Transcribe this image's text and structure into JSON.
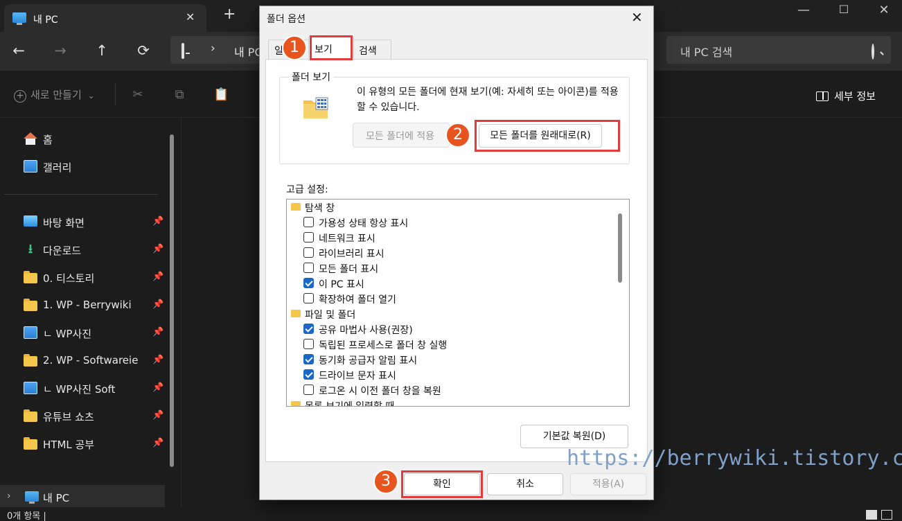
{
  "explorer": {
    "tab_title": "내 PC",
    "tab_close": "✕",
    "new_tab": "+",
    "window_controls": {
      "minimize": "—",
      "maximize": "☐",
      "close": "✕"
    },
    "nav": {
      "back": "←",
      "forward": "→",
      "up": "↑",
      "refresh": "⟳"
    },
    "address": {
      "chevron": "›",
      "crumb": "내 PC"
    },
    "search": {
      "placeholder": "내 PC 검색"
    },
    "command_bar": {
      "new_label": "새로 만들기",
      "new_chevron": "⌄",
      "details_label": "세부 정보"
    },
    "sidebar": {
      "items": [
        {
          "label": "홈",
          "icon": "home-icon",
          "pinned": false
        },
        {
          "label": "갤러리",
          "icon": "gallery-icon",
          "pinned": false
        },
        {
          "label": "바탕 화면",
          "icon": "desktop-icon",
          "pinned": true
        },
        {
          "label": "다운로드",
          "icon": "download-icon",
          "pinned": true
        },
        {
          "label": "0. 티스토리",
          "icon": "folder-icon",
          "pinned": true
        },
        {
          "label": "1. WP - Berrywiki",
          "icon": "folder-icon",
          "pinned": true
        },
        {
          "label": "ㄴ WP사진",
          "icon": "image-icon",
          "pinned": true
        },
        {
          "label": "2. WP - Softwareie",
          "icon": "folder-icon",
          "pinned": true
        },
        {
          "label": "ㄴ WP사진 Soft",
          "icon": "image-icon",
          "pinned": true
        },
        {
          "label": "유튜브 쇼츠",
          "icon": "folder-icon",
          "pinned": true
        },
        {
          "label": "HTML 공부",
          "icon": "folder-icon",
          "pinned": true
        }
      ],
      "pin_glyph": "📌",
      "this_pc": {
        "chevron": "›",
        "label": "내 PC"
      }
    },
    "status": {
      "text": "0개 항목  |"
    }
  },
  "dialog": {
    "title": "폴더 옵션",
    "close": "✕",
    "tabs": [
      {
        "label": "일반"
      },
      {
        "label": "보기"
      },
      {
        "label": "검색"
      }
    ],
    "folder_view": {
      "legend": "폴더 보기",
      "description": "이 유형의 모든 폴더에 현재 보기(예: 자세히 또는 아이콘)를 적용할 수 있습니다.",
      "apply_all": "모든 폴더에 적용",
      "reset_all": "모든 폴더를 원래대로(R)"
    },
    "advanced": {
      "label": "고급 설정:",
      "rows": [
        {
          "type": "group",
          "label": "탐색 창"
        },
        {
          "type": "check",
          "label": "가용성 상태 항상 표시",
          "checked": false
        },
        {
          "type": "check",
          "label": "네트워크 표시",
          "checked": false
        },
        {
          "type": "check",
          "label": "라이브러리 표시",
          "checked": false
        },
        {
          "type": "check",
          "label": "모든 폴더 표시",
          "checked": false
        },
        {
          "type": "check",
          "label": "이 PC 표시",
          "checked": true
        },
        {
          "type": "check",
          "label": "확장하여 폴더 열기",
          "checked": false
        },
        {
          "type": "group",
          "label": "파일 및 폴더"
        },
        {
          "type": "check",
          "label": "공유 마법사 사용(권장)",
          "checked": true
        },
        {
          "type": "check",
          "label": "독립된 프로세스로 폴더 창 실행",
          "checked": false
        },
        {
          "type": "check",
          "label": "동기화 공급자 알림 표시",
          "checked": true
        },
        {
          "type": "check",
          "label": "드라이브 문자 표시",
          "checked": true
        },
        {
          "type": "check",
          "label": "로그온 시 이전 폴더 창을 복원",
          "checked": false
        },
        {
          "type": "group",
          "label": "목록 보기에 입력할 때"
        }
      ]
    },
    "restore_defaults": "기본값 복원(D)",
    "buttons": {
      "ok": "확인",
      "cancel": "취소",
      "apply": "적용(A)"
    },
    "annotations": [
      "1",
      "2",
      "3"
    ],
    "accent_color": "#e23b3b"
  },
  "watermark": "https://berrywiki.tistory.com"
}
